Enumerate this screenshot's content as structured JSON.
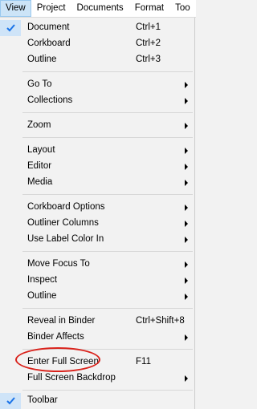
{
  "menubar": {
    "items": [
      {
        "label": "View"
      },
      {
        "label": "Project"
      },
      {
        "label": "Documents"
      },
      {
        "label": "Format"
      },
      {
        "label": "Too"
      }
    ]
  },
  "menu": {
    "items": [
      {
        "label": "Document",
        "shortcut": "Ctrl+1",
        "checked": true
      },
      {
        "label": "Corkboard",
        "shortcut": "Ctrl+2"
      },
      {
        "label": "Outline",
        "shortcut": "Ctrl+3"
      },
      {
        "label": "Go To",
        "submenu": true
      },
      {
        "label": "Collections",
        "submenu": true
      },
      {
        "label": "Zoom",
        "submenu": true
      },
      {
        "label": "Layout",
        "submenu": true
      },
      {
        "label": "Editor",
        "submenu": true
      },
      {
        "label": "Media",
        "submenu": true
      },
      {
        "label": "Corkboard Options",
        "submenu": true
      },
      {
        "label": "Outliner Columns",
        "submenu": true
      },
      {
        "label": "Use Label Color In",
        "submenu": true
      },
      {
        "label": "Move Focus To",
        "submenu": true
      },
      {
        "label": "Inspect",
        "submenu": true
      },
      {
        "label": "Outline",
        "submenu": true
      },
      {
        "label": "Reveal in Binder",
        "shortcut": "Ctrl+Shift+8"
      },
      {
        "label": "Binder Affects",
        "submenu": true
      },
      {
        "label": "Enter Full Screen",
        "shortcut": "F11",
        "annotated": true
      },
      {
        "label": "Full Screen Backdrop",
        "submenu": true
      },
      {
        "label": "Toolbar",
        "checked": true
      }
    ]
  },
  "colors": {
    "annotation": "#d9221b",
    "check": "#1a73e8"
  }
}
